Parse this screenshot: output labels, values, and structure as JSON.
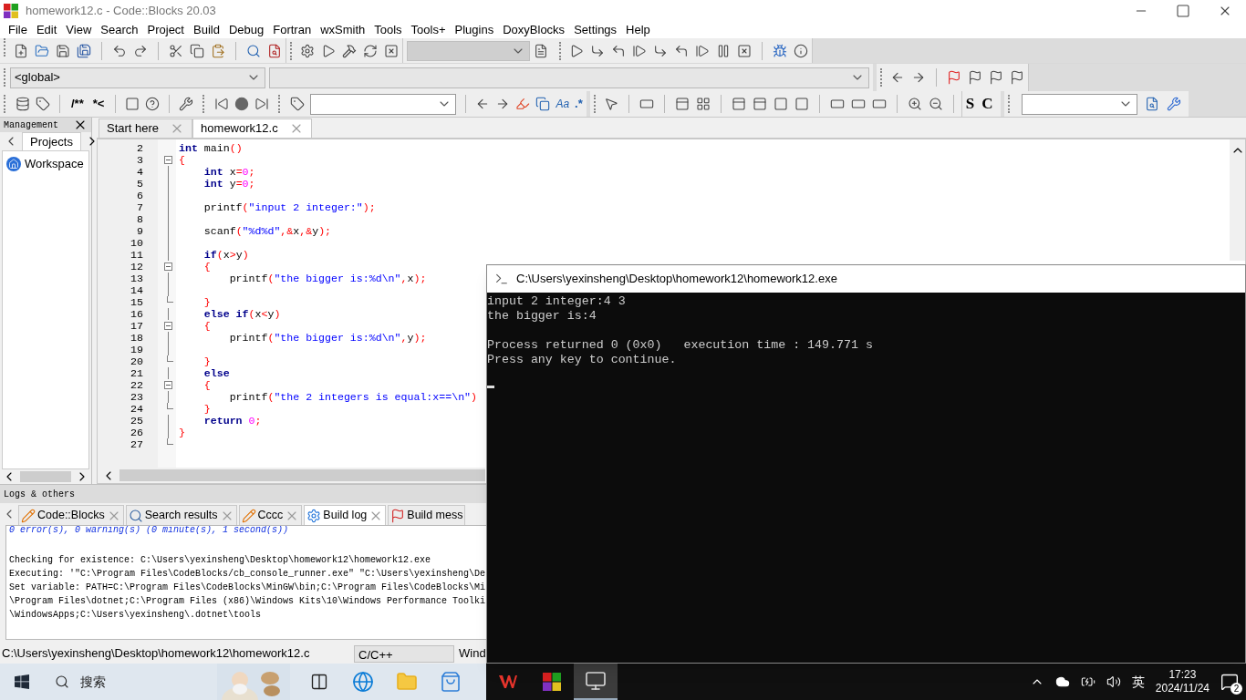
{
  "window": {
    "title": "homework12.c - Code::Blocks 20.03"
  },
  "menu": [
    "File",
    "Edit",
    "View",
    "Search",
    "Project",
    "Build",
    "Debug",
    "Fortran",
    "wxSmith",
    "Tools",
    "Tools+",
    "Plugins",
    "DoxyBlocks",
    "Settings",
    "Help"
  ],
  "toolbars": {
    "scope": "<global>",
    "comment_buttons": [
      "/**",
      "*<"
    ],
    "case_button": "Aa",
    "regex_button": ".*",
    "style_buttons": [
      "S",
      "C"
    ]
  },
  "management": {
    "title": "Management",
    "tabs": [
      {
        "label": "Projects",
        "selected": true
      }
    ],
    "tree": [
      {
        "label": "Workspace"
      }
    ]
  },
  "editor": {
    "tabs": [
      {
        "label": "Start here",
        "selected": false
      },
      {
        "label": "homework12.c",
        "selected": true
      }
    ],
    "lines": [
      {
        "number": "2",
        "kind": "plain",
        "tokens": [
          {
            "kind": "keyword",
            "text": "int"
          },
          {
            "kind": "plain",
            "text": " main"
          },
          {
            "kind": "op",
            "text": "()"
          }
        ]
      },
      {
        "number": "3",
        "kind": "fold-start",
        "tokens": [
          {
            "kind": "op",
            "text": "{"
          }
        ]
      },
      {
        "number": "4",
        "kind": "fold-body",
        "tokens": [
          {
            "kind": "keyword",
            "text": "    int"
          },
          {
            "kind": "plain",
            "text": " x"
          },
          {
            "kind": "op",
            "text": "="
          },
          {
            "kind": "number",
            "text": "0"
          },
          {
            "kind": "op",
            "text": ";"
          }
        ]
      },
      {
        "number": "5",
        "kind": "fold-body",
        "tokens": [
          {
            "kind": "keyword",
            "text": "    int"
          },
          {
            "kind": "plain",
            "text": " y"
          },
          {
            "kind": "op",
            "text": "="
          },
          {
            "kind": "number",
            "text": "0"
          },
          {
            "kind": "op",
            "text": ";"
          }
        ]
      },
      {
        "number": "6",
        "kind": "fold-body"
      },
      {
        "number": "7",
        "kind": "fold-body",
        "tokens": [
          {
            "kind": "plain",
            "text": "    printf"
          },
          {
            "kind": "op",
            "text": "("
          },
          {
            "kind": "string",
            "text": "\"input 2 integer:\""
          },
          {
            "kind": "op",
            "text": ");"
          }
        ]
      },
      {
        "number": "8",
        "kind": "fold-body"
      },
      {
        "number": "9",
        "kind": "fold-body",
        "tokens": [
          {
            "kind": "plain",
            "text": "    scanf"
          },
          {
            "kind": "op",
            "text": "("
          },
          {
            "kind": "string",
            "text": "\"%d%d\""
          },
          {
            "kind": "op",
            "text": ",&"
          },
          {
            "kind": "plain",
            "text": "x"
          },
          {
            "kind": "op",
            "text": ",&"
          },
          {
            "kind": "plain",
            "text": "y"
          },
          {
            "kind": "op",
            "text": ");"
          }
        ]
      },
      {
        "number": "10",
        "kind": "fold-body"
      },
      {
        "number": "11",
        "kind": "fold-body",
        "tokens": [
          {
            "kind": "keyword",
            "text": "    if"
          },
          {
            "kind": "op",
            "text": "("
          },
          {
            "kind": "plain",
            "text": "x"
          },
          {
            "kind": "op",
            "text": ">"
          },
          {
            "kind": "plain",
            "text": "y"
          },
          {
            "kind": "op",
            "text": ")"
          }
        ]
      },
      {
        "number": "12",
        "kind": "fold-start",
        "tokens": [
          {
            "kind": "op",
            "text": "    {"
          }
        ]
      },
      {
        "number": "13",
        "kind": "fold-body",
        "tokens": [
          {
            "kind": "plain",
            "text": "        printf"
          },
          {
            "kind": "op",
            "text": "("
          },
          {
            "kind": "string",
            "text": "\"the bigger is:%d\\n\""
          },
          {
            "kind": "op",
            "text": ","
          },
          {
            "kind": "plain",
            "text": "x"
          },
          {
            "kind": "op",
            "text": ");"
          }
        ]
      },
      {
        "number": "14",
        "kind": "fold-body"
      },
      {
        "number": "15",
        "kind": "fold-end",
        "tokens": [
          {
            "kind": "op",
            "text": "    }"
          }
        ]
      },
      {
        "number": "16",
        "kind": "fold-body",
        "tokens": [
          {
            "kind": "keyword",
            "text": "    else if"
          },
          {
            "kind": "op",
            "text": "("
          },
          {
            "kind": "plain",
            "text": "x"
          },
          {
            "kind": "op",
            "text": "<"
          },
          {
            "kind": "plain",
            "text": "y"
          },
          {
            "kind": "op",
            "text": ")"
          }
        ]
      },
      {
        "number": "17",
        "kind": "fold-start",
        "tokens": [
          {
            "kind": "op",
            "text": "    {"
          }
        ]
      },
      {
        "number": "18",
        "kind": "fold-body",
        "tokens": [
          {
            "kind": "plain",
            "text": "        printf"
          },
          {
            "kind": "op",
            "text": "("
          },
          {
            "kind": "string",
            "text": "\"the bigger is:%d\\n\""
          },
          {
            "kind": "op",
            "text": ","
          },
          {
            "kind": "plain",
            "text": "y"
          },
          {
            "kind": "op",
            "text": ");"
          }
        ]
      },
      {
        "number": "19",
        "kind": "fold-body"
      },
      {
        "number": "20",
        "kind": "fold-end",
        "tokens": [
          {
            "kind": "op",
            "text": "    }"
          }
        ]
      },
      {
        "number": "21",
        "kind": "fold-body",
        "tokens": [
          {
            "kind": "keyword",
            "text": "    else"
          }
        ]
      },
      {
        "number": "22",
        "kind": "fold-start",
        "tokens": [
          {
            "kind": "op",
            "text": "    {"
          }
        ]
      },
      {
        "number": "23",
        "kind": "fold-body",
        "tokens": [
          {
            "kind": "plain",
            "text": "        printf"
          },
          {
            "kind": "op",
            "text": "("
          },
          {
            "kind": "string",
            "text": "\"the 2 integers is equal:x==\\n\""
          },
          {
            "kind": "op",
            "text": ")"
          }
        ]
      },
      {
        "number": "24",
        "kind": "fold-end",
        "tokens": [
          {
            "kind": "op",
            "text": "    }"
          }
        ]
      },
      {
        "number": "25",
        "kind": "fold-body",
        "tokens": [
          {
            "kind": "keyword",
            "text": "    return"
          },
          {
            "kind": "number",
            "text": " 0"
          },
          {
            "kind": "op",
            "text": ";"
          }
        ]
      },
      {
        "number": "26",
        "kind": "fold-body",
        "tokens": [
          {
            "kind": "op",
            "text": "}"
          }
        ]
      },
      {
        "number": "27",
        "kind": "fold-end"
      }
    ]
  },
  "logs": {
    "title": "Logs & others",
    "tabs": [
      {
        "label": "Code::Blocks",
        "kind": "note",
        "selected": false,
        "close_button": true
      },
      {
        "label": "Search results",
        "kind": "search",
        "selected": false,
        "close_button": true
      },
      {
        "label": "Cccc",
        "kind": "note",
        "selected": false,
        "close_button": true
      },
      {
        "label": "Build log",
        "kind": "gear",
        "selected": true,
        "close_button": true
      },
      {
        "label": "Build mess",
        "kind": "flag",
        "selected": false,
        "close_button": false
      }
    ],
    "lines": [
      {
        "kind": "summary",
        "text": "0 error(s), 0 warning(s) (0 minute(s), 1 second(s))"
      },
      {
        "kind": "blank"
      },
      {
        "kind": "text",
        "text": "Checking for existence: C:\\Users\\yexinsheng\\Desktop\\homework12\\homework12.exe"
      },
      {
        "kind": "text",
        "text": "Executing: '\"C:\\Program Files\\CodeBlocks/cb_console_runner.exe\" \"C:\\Users\\yexinsheng\\De"
      },
      {
        "kind": "text",
        "text": "Set variable: PATH=C:\\Program Files\\CodeBlocks\\MinGW\\bin;C:\\Program Files\\CodeBlocks\\Mi"
      },
      {
        "kind": "text",
        "text": "\\Program Files\\dotnet;C:\\Program Files (x86)\\Windows Kits\\10\\Windows Performance Toolki"
      },
      {
        "kind": "text",
        "text": "\\WindowsApps;C:\\Users\\yexinsheng\\.dotnet\\tools"
      }
    ]
  },
  "status_bar": [
    "C:\\Users\\yexinsheng\\Desktop\\homework12\\homework12.c",
    "C/C++",
    "Wind"
  ],
  "console": {
    "title": "C:\\Users\\yexinsheng\\Desktop\\homework12\\homework12.exe",
    "cursor": true,
    "lines": [
      {
        "kind": "text",
        "text": "input 2 integer:4 3"
      },
      {
        "kind": "text",
        "text": "the bigger is:4"
      },
      {
        "kind": "blank"
      },
      {
        "kind": "text",
        "text": "Process returned 0 (0x0)   execution time : 149.771 s"
      },
      {
        "kind": "text",
        "text": "Press any key to continue."
      }
    ]
  },
  "taskbar": {
    "search_placeholder": "搜索",
    "apps": [
      {
        "kind": "task-view",
        "active": false
      },
      {
        "kind": "browser",
        "active": false
      },
      {
        "kind": "folder",
        "active": false
      },
      {
        "kind": "store",
        "active": false
      },
      {
        "kind": "office",
        "active": false
      },
      {
        "kind": "codeblocks",
        "active": false
      },
      {
        "kind": "console",
        "active": true
      }
    ],
    "tray": {
      "input": "英",
      "time": "17:23",
      "date": "2024/11/24",
      "notifications": "2"
    }
  }
}
